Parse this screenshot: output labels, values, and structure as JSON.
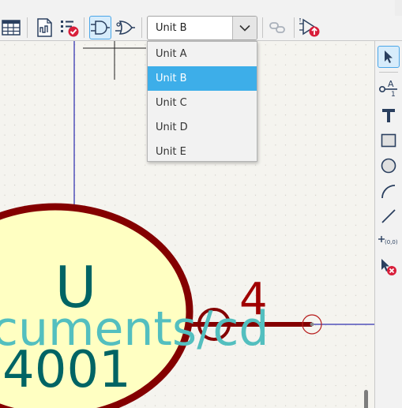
{
  "toolbar": {
    "buttons": [
      {
        "name": "symbol-fields-table-icon"
      },
      {
        "name": "datasheet-icon"
      },
      {
        "name": "check-symbol-icon"
      },
      {
        "name": "show-as-demorgan-normal-icon",
        "active": true
      },
      {
        "name": "show-as-demorgan-alternate-icon"
      },
      {
        "name": "synchronized-pins-icon"
      },
      {
        "name": "update-symbol-icon"
      }
    ],
    "unit_select": {
      "value": "Unit B",
      "options": [
        "Unit A",
        "Unit B",
        "Unit C",
        "Unit D",
        "Unit E"
      ],
      "selected_index": 1
    }
  },
  "canvas": {
    "reference": "U",
    "value_partial": "cuments/cd",
    "part_number": "4001",
    "pin_number": "4",
    "colors": {
      "body_outline": "#840000",
      "body_fill": "#ffffc2",
      "text_teal": "#006464",
      "text_cyan": "#53bfbf",
      "pin": "#a00000",
      "wire_blue": "#0000a0",
      "grid_bg": "#f5f4ef"
    }
  },
  "right_toolbar": {
    "tools": [
      {
        "name": "select-tool-icon",
        "active": true
      },
      {
        "name": "add-pin-icon"
      },
      {
        "name": "add-text-icon"
      },
      {
        "name": "add-rectangle-icon"
      },
      {
        "name": "add-circle-icon"
      },
      {
        "name": "add-arc-icon"
      },
      {
        "name": "add-line-icon"
      },
      {
        "name": "set-anchor-icon",
        "label": "(0,0)"
      },
      {
        "name": "delete-tool-icon"
      }
    ]
  }
}
